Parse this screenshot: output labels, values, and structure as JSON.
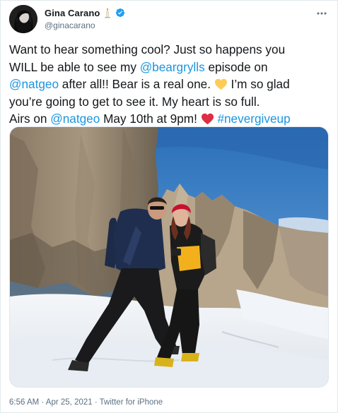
{
  "user": {
    "display_name": "Gina Carano",
    "handle": "@ginacarano",
    "emoji_icon": "candle-icon",
    "badge_icon": "verified-badge-icon"
  },
  "menu": {
    "icon": "more-horizontal-icon"
  },
  "tweet": {
    "line1": "Want to hear something cool? Just so happens you",
    "line2_a": "WILL be able to see my ",
    "mention_beargrylls": "@beargrylls",
    "line2_b": " episode on",
    "mention_natgeo_1": "@natgeo",
    "line3_a": " after all!! Bear is a real one. ",
    "line3_emoji": "yellow-heart-icon",
    "line3_b": " I’m so glad",
    "line4": "you’re going to get to see it. My heart is so full.",
    "line5_a": "Airs on ",
    "mention_natgeo_2": "@natgeo",
    "line5_b": " May 10th at 9pm! ",
    "line5_emoji": "red-heart-icon",
    "hashtag": "#nevergiveup"
  },
  "media": {
    "kind": "photo",
    "description_icon": "mountain-photo"
  },
  "meta": {
    "time": "6:56 AM",
    "separator1": " · ",
    "date": "Apr 25, 2021",
    "separator2": " · ",
    "source": "Twitter for iPhone"
  },
  "colors": {
    "link": "#1b95e0",
    "text": "#14171a",
    "secondary": "#5b7083",
    "verified": "#1da1f2"
  }
}
